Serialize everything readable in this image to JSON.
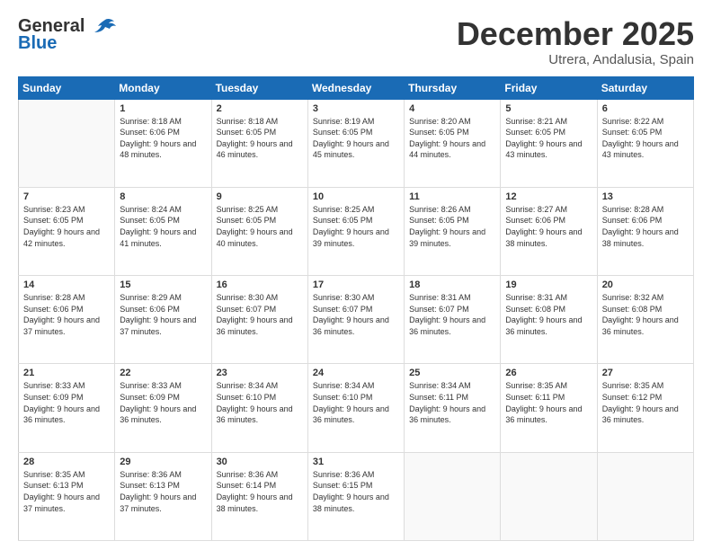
{
  "header": {
    "logo_general": "General",
    "logo_blue": "Blue",
    "month_title": "December 2025",
    "subtitle": "Utrera, Andalusia, Spain"
  },
  "weekdays": [
    "Sunday",
    "Monday",
    "Tuesday",
    "Wednesday",
    "Thursday",
    "Friday",
    "Saturday"
  ],
  "weeks": [
    [
      {
        "day": "",
        "sunrise": "",
        "sunset": "",
        "daylight": ""
      },
      {
        "day": "1",
        "sunrise": "Sunrise: 8:18 AM",
        "sunset": "Sunset: 6:06 PM",
        "daylight": "Daylight: 9 hours and 48 minutes."
      },
      {
        "day": "2",
        "sunrise": "Sunrise: 8:18 AM",
        "sunset": "Sunset: 6:05 PM",
        "daylight": "Daylight: 9 hours and 46 minutes."
      },
      {
        "day": "3",
        "sunrise": "Sunrise: 8:19 AM",
        "sunset": "Sunset: 6:05 PM",
        "daylight": "Daylight: 9 hours and 45 minutes."
      },
      {
        "day": "4",
        "sunrise": "Sunrise: 8:20 AM",
        "sunset": "Sunset: 6:05 PM",
        "daylight": "Daylight: 9 hours and 44 minutes."
      },
      {
        "day": "5",
        "sunrise": "Sunrise: 8:21 AM",
        "sunset": "Sunset: 6:05 PM",
        "daylight": "Daylight: 9 hours and 43 minutes."
      },
      {
        "day": "6",
        "sunrise": "Sunrise: 8:22 AM",
        "sunset": "Sunset: 6:05 PM",
        "daylight": "Daylight: 9 hours and 43 minutes."
      }
    ],
    [
      {
        "day": "7",
        "sunrise": "Sunrise: 8:23 AM",
        "sunset": "Sunset: 6:05 PM",
        "daylight": "Daylight: 9 hours and 42 minutes."
      },
      {
        "day": "8",
        "sunrise": "Sunrise: 8:24 AM",
        "sunset": "Sunset: 6:05 PM",
        "daylight": "Daylight: 9 hours and 41 minutes."
      },
      {
        "day": "9",
        "sunrise": "Sunrise: 8:25 AM",
        "sunset": "Sunset: 6:05 PM",
        "daylight": "Daylight: 9 hours and 40 minutes."
      },
      {
        "day": "10",
        "sunrise": "Sunrise: 8:25 AM",
        "sunset": "Sunset: 6:05 PM",
        "daylight": "Daylight: 9 hours and 39 minutes."
      },
      {
        "day": "11",
        "sunrise": "Sunrise: 8:26 AM",
        "sunset": "Sunset: 6:05 PM",
        "daylight": "Daylight: 9 hours and 39 minutes."
      },
      {
        "day": "12",
        "sunrise": "Sunrise: 8:27 AM",
        "sunset": "Sunset: 6:06 PM",
        "daylight": "Daylight: 9 hours and 38 minutes."
      },
      {
        "day": "13",
        "sunrise": "Sunrise: 8:28 AM",
        "sunset": "Sunset: 6:06 PM",
        "daylight": "Daylight: 9 hours and 38 minutes."
      }
    ],
    [
      {
        "day": "14",
        "sunrise": "Sunrise: 8:28 AM",
        "sunset": "Sunset: 6:06 PM",
        "daylight": "Daylight: 9 hours and 37 minutes."
      },
      {
        "day": "15",
        "sunrise": "Sunrise: 8:29 AM",
        "sunset": "Sunset: 6:06 PM",
        "daylight": "Daylight: 9 hours and 37 minutes."
      },
      {
        "day": "16",
        "sunrise": "Sunrise: 8:30 AM",
        "sunset": "Sunset: 6:07 PM",
        "daylight": "Daylight: 9 hours and 36 minutes."
      },
      {
        "day": "17",
        "sunrise": "Sunrise: 8:30 AM",
        "sunset": "Sunset: 6:07 PM",
        "daylight": "Daylight: 9 hours and 36 minutes."
      },
      {
        "day": "18",
        "sunrise": "Sunrise: 8:31 AM",
        "sunset": "Sunset: 6:07 PM",
        "daylight": "Daylight: 9 hours and 36 minutes."
      },
      {
        "day": "19",
        "sunrise": "Sunrise: 8:31 AM",
        "sunset": "Sunset: 6:08 PM",
        "daylight": "Daylight: 9 hours and 36 minutes."
      },
      {
        "day": "20",
        "sunrise": "Sunrise: 8:32 AM",
        "sunset": "Sunset: 6:08 PM",
        "daylight": "Daylight: 9 hours and 36 minutes."
      }
    ],
    [
      {
        "day": "21",
        "sunrise": "Sunrise: 8:33 AM",
        "sunset": "Sunset: 6:09 PM",
        "daylight": "Daylight: 9 hours and 36 minutes."
      },
      {
        "day": "22",
        "sunrise": "Sunrise: 8:33 AM",
        "sunset": "Sunset: 6:09 PM",
        "daylight": "Daylight: 9 hours and 36 minutes."
      },
      {
        "day": "23",
        "sunrise": "Sunrise: 8:34 AM",
        "sunset": "Sunset: 6:10 PM",
        "daylight": "Daylight: 9 hours and 36 minutes."
      },
      {
        "day": "24",
        "sunrise": "Sunrise: 8:34 AM",
        "sunset": "Sunset: 6:10 PM",
        "daylight": "Daylight: 9 hours and 36 minutes."
      },
      {
        "day": "25",
        "sunrise": "Sunrise: 8:34 AM",
        "sunset": "Sunset: 6:11 PM",
        "daylight": "Daylight: 9 hours and 36 minutes."
      },
      {
        "day": "26",
        "sunrise": "Sunrise: 8:35 AM",
        "sunset": "Sunset: 6:11 PM",
        "daylight": "Daylight: 9 hours and 36 minutes."
      },
      {
        "day": "27",
        "sunrise": "Sunrise: 8:35 AM",
        "sunset": "Sunset: 6:12 PM",
        "daylight": "Daylight: 9 hours and 36 minutes."
      }
    ],
    [
      {
        "day": "28",
        "sunrise": "Sunrise: 8:35 AM",
        "sunset": "Sunset: 6:13 PM",
        "daylight": "Daylight: 9 hours and 37 minutes."
      },
      {
        "day": "29",
        "sunrise": "Sunrise: 8:36 AM",
        "sunset": "Sunset: 6:13 PM",
        "daylight": "Daylight: 9 hours and 37 minutes."
      },
      {
        "day": "30",
        "sunrise": "Sunrise: 8:36 AM",
        "sunset": "Sunset: 6:14 PM",
        "daylight": "Daylight: 9 hours and 38 minutes."
      },
      {
        "day": "31",
        "sunrise": "Sunrise: 8:36 AM",
        "sunset": "Sunset: 6:15 PM",
        "daylight": "Daylight: 9 hours and 38 minutes."
      },
      {
        "day": "",
        "sunrise": "",
        "sunset": "",
        "daylight": ""
      },
      {
        "day": "",
        "sunrise": "",
        "sunset": "",
        "daylight": ""
      },
      {
        "day": "",
        "sunrise": "",
        "sunset": "",
        "daylight": ""
      }
    ]
  ]
}
